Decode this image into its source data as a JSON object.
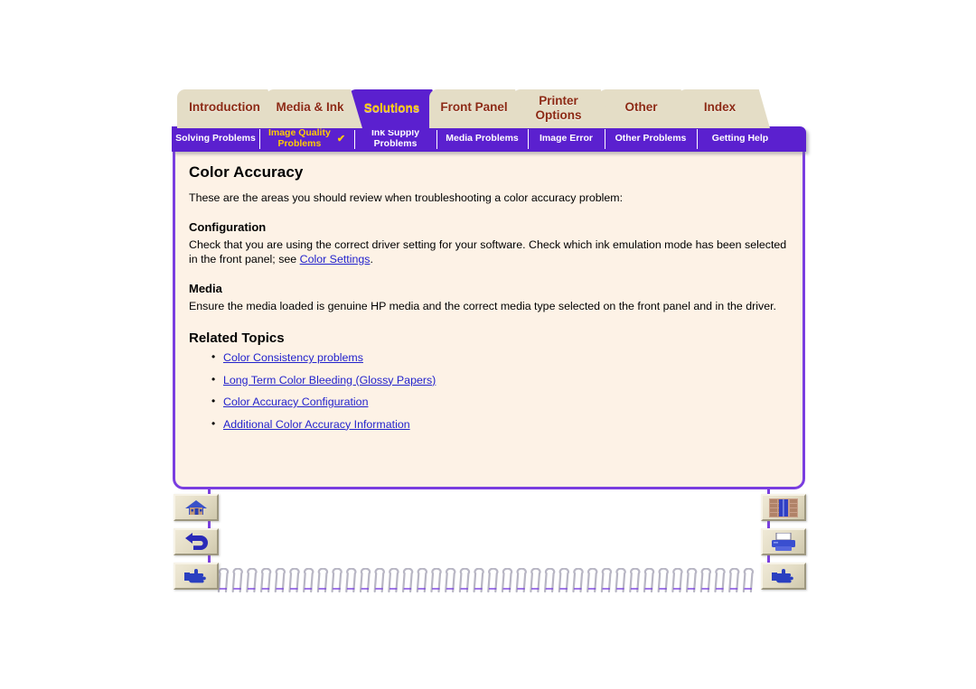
{
  "main_tabs": [
    {
      "label": "Introduction",
      "active": false,
      "lines": [
        "Introduction"
      ]
    },
    {
      "label": "Media & Ink",
      "active": false,
      "lines": [
        "Media & Ink"
      ]
    },
    {
      "label": "Solutions",
      "active": true,
      "lines": [
        "Solutions"
      ]
    },
    {
      "label": "Front Panel",
      "active": false,
      "lines": [
        "Front Panel"
      ]
    },
    {
      "label": "Printer Options",
      "active": false,
      "lines": [
        "Printer",
        "Options"
      ]
    },
    {
      "label": "Other",
      "active": false,
      "lines": [
        "Other"
      ]
    },
    {
      "label": "Index",
      "active": false,
      "lines": [
        "Index"
      ]
    }
  ],
  "sub_tabs": [
    {
      "label": "Solving Problems",
      "lines": [
        "Solving Problems"
      ],
      "current": false,
      "check": ""
    },
    {
      "label": "Image Quality Problems",
      "lines": [
        "Image Quality",
        "Problems"
      ],
      "current": true,
      "check": "✔"
    },
    {
      "label": "Ink Supply Problems",
      "lines": [
        "Ink Supply",
        "Problems"
      ],
      "current": false,
      "check": ""
    },
    {
      "label": "Media Problems",
      "lines": [
        "Media Problems"
      ],
      "current": false,
      "check": ""
    },
    {
      "label": "Image Error",
      "lines": [
        "Image Error"
      ],
      "current": false,
      "check": ""
    },
    {
      "label": "Other Problems",
      "lines": [
        "Other Problems"
      ],
      "current": false,
      "check": ""
    },
    {
      "label": "Getting Help",
      "lines": [
        "Getting Help"
      ],
      "current": false,
      "check": ""
    }
  ],
  "content": {
    "title": "Color Accuracy",
    "intro": "These are the areas you should review when troubleshooting a color accuracy problem:",
    "section1_heading": "Configuration",
    "section1_text_before": "Check that you are using the correct driver setting for your software. Check which ink emulation mode has been selected in the front panel; see ",
    "section1_link": "Color Settings",
    "section1_text_after": ".",
    "section2_heading": "Media",
    "section2_text": "Ensure the media loaded is genuine HP media and the correct media type selected on the front panel and in the driver.",
    "related_heading": "Related Topics",
    "related_links": [
      "Color Consistency problems",
      "Long Term Color Bleeding (Glossy Papers)",
      "Color Accuracy Configuration",
      "Additional Color Accuracy Information"
    ]
  },
  "nav_buttons": {
    "home": "home-icon",
    "back": "back-arrow-icon",
    "forward": "forward-hand-icon",
    "index": "bookshelf-icon",
    "print": "printer-icon",
    "previous": "previous-hand-icon"
  },
  "colors": {
    "accent_purple": "#5b20cf",
    "border_purple": "#7a3ee0",
    "tab_beige": "#e4ddc6",
    "tab_text_red": "#8c2a14",
    "active_tab_text": "#ffcc00",
    "page_bg": "#fdf2e6",
    "link_blue": "#2222cc"
  }
}
